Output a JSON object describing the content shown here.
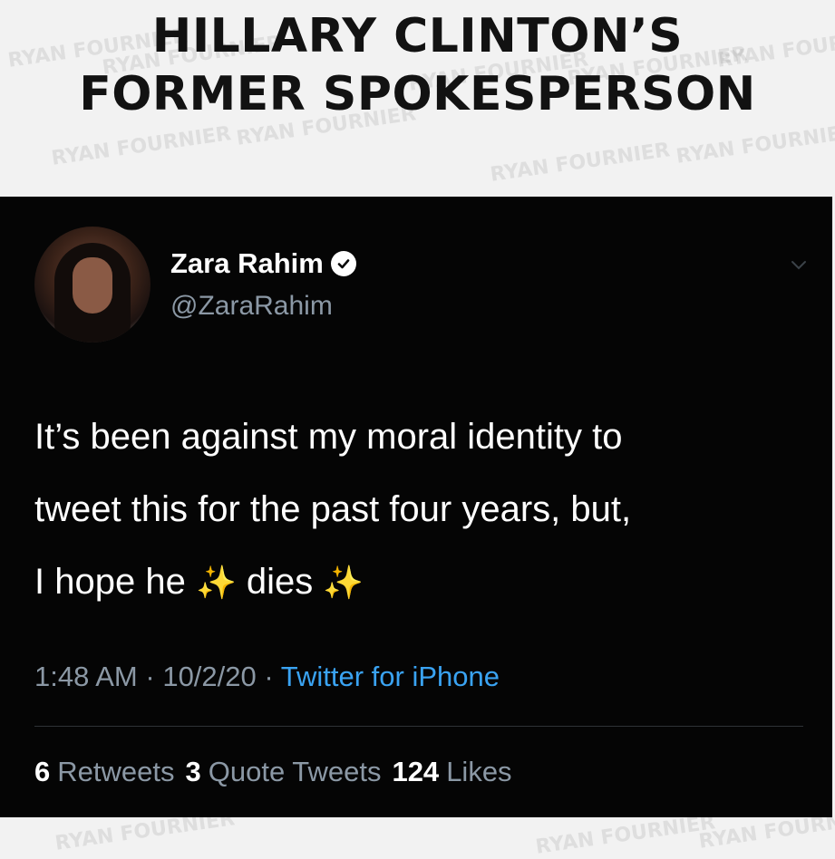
{
  "headline": {
    "line1": "HILLARY CLINTON’S",
    "line2": "FORMER SPOKESPERSON"
  },
  "watermark_text": "RYAN FOURNIER",
  "tweet": {
    "author_name": "Zara Rahim",
    "handle": "@ZaraRahim",
    "verified": true,
    "body_line1": "It’s been against my moral identity to",
    "body_line2": "tweet this for the past four years, but,",
    "body_line3_a": "I hope he",
    "body_line3_b": "dies",
    "sparkle": "✨",
    "time": "1:48 AM",
    "date": "10/2/20",
    "source": "Twitter for iPhone",
    "separator": "·",
    "stats": {
      "retweets_count": "6",
      "retweets_label": "Retweets",
      "quote_count": "3",
      "quote_label": "Quote Tweets",
      "likes_count": "124",
      "likes_label": "Likes"
    }
  },
  "colors": {
    "tweet_background": "#050505",
    "secondary_text": "#8b98a5",
    "link": "#3aa3f2",
    "headline": "#121212"
  },
  "icons": [
    "verified-badge-icon",
    "chevron-down-icon",
    "sparkle-icon"
  ]
}
